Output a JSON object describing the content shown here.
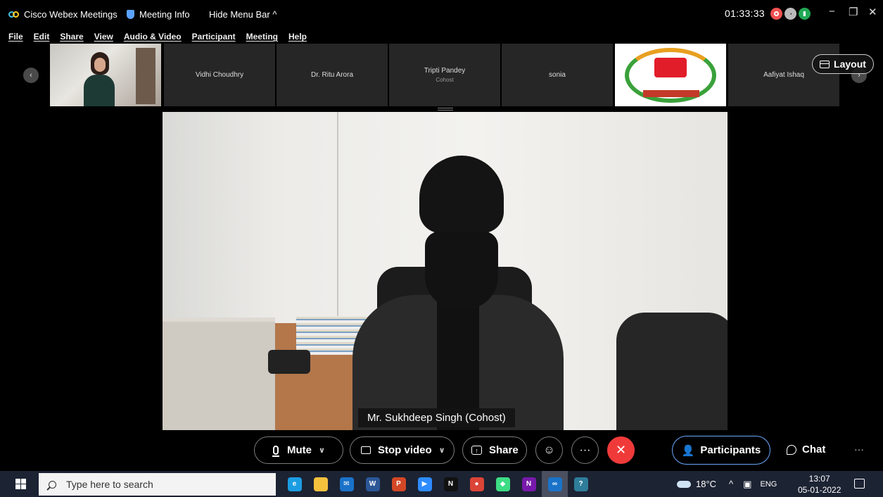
{
  "titlebar": {
    "app_name": "Cisco Webex Meetings",
    "meeting_info": "Meeting Info",
    "hide_menu": "Hide Menu Bar",
    "hide_menu_arrow": "^",
    "timer": "01:33:33",
    "minimize": "−",
    "restore": "❐",
    "close": "✕"
  },
  "menu": [
    "File",
    "Edit",
    "Share",
    "View",
    "Audio & Video",
    "Participant",
    "Meeting",
    "Help"
  ],
  "filmstrip": {
    "prev": "‹",
    "next": "›",
    "tiles": [
      {
        "name": "Vidhi Choudhry",
        "sub": ""
      },
      {
        "name": "Dr. Ritu Arora",
        "sub": ""
      },
      {
        "name": "Tripti Pandey",
        "sub": "Cohost"
      },
      {
        "name": "sonia",
        "sub": ""
      },
      {
        "name": "Aafiyat Ishaq",
        "sub": ""
      }
    ],
    "layout_label": "Layout"
  },
  "stage": {
    "speaker_label": "Mr. Sukhdeep Singh (Cohost)"
  },
  "controls": {
    "mute": "Mute",
    "stop_video": "Stop video",
    "share": "Share",
    "reactions_icon": "☺",
    "more": "···",
    "end": "✕",
    "participants": "Participants",
    "chat": "Chat",
    "more_right": "···",
    "chevron": "∨"
  },
  "taskbar": {
    "search_placeholder": "Type here to search",
    "apps": [
      {
        "icon": "edge-icon",
        "glyph": "e",
        "color": "#1b9de2"
      },
      {
        "icon": "file-explorer-icon",
        "glyph": "",
        "color": "#f4c13d"
      },
      {
        "icon": "mail-icon",
        "glyph": "✉",
        "color": "#1a73c9"
      },
      {
        "icon": "word-icon",
        "glyph": "W",
        "color": "#2b5797"
      },
      {
        "icon": "powerpoint-icon",
        "glyph": "P",
        "color": "#d24726"
      },
      {
        "icon": "zoom-icon",
        "glyph": "▶",
        "color": "#2d8cff"
      },
      {
        "icon": "netflix-icon",
        "glyph": "N",
        "color": "#111111"
      },
      {
        "icon": "chrome-icon",
        "glyph": "●",
        "color": "#db4437"
      },
      {
        "icon": "android-studio-icon",
        "glyph": "◆",
        "color": "#3ddc84"
      },
      {
        "icon": "onenote-icon",
        "glyph": "N",
        "color": "#7719aa"
      },
      {
        "icon": "webex-icon",
        "glyph": "∞",
        "color": "#1a73c9"
      },
      {
        "icon": "help-icon",
        "glyph": "?",
        "color": "#2e7d9a"
      }
    ],
    "weather": "18°C",
    "tray_arrow": "^",
    "language": "ENG",
    "time": "13:07",
    "date": "05-01-2022"
  }
}
